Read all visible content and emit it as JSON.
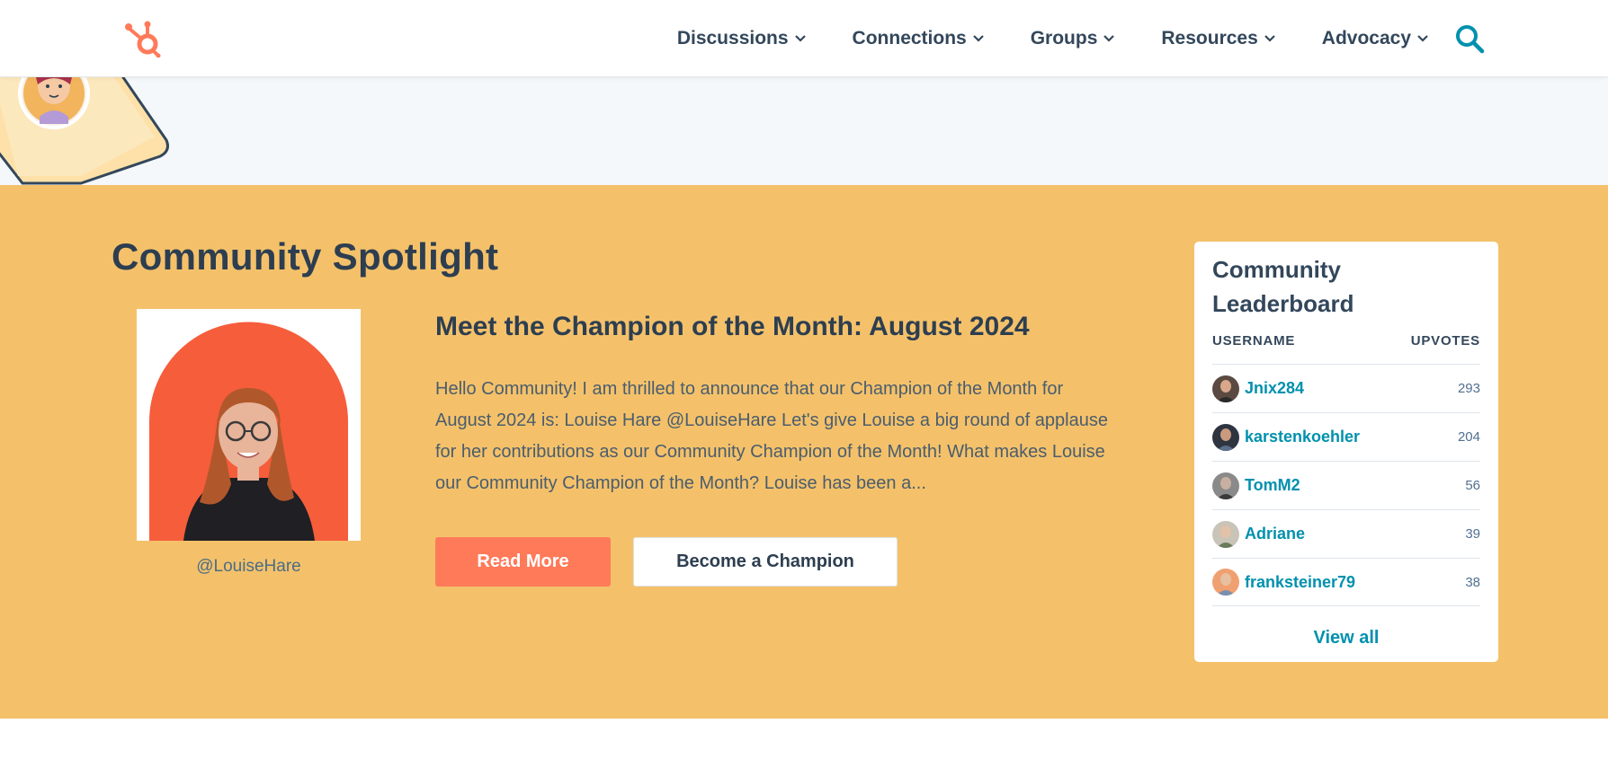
{
  "nav": {
    "items": [
      {
        "label": "Discussions"
      },
      {
        "label": "Connections"
      },
      {
        "label": "Groups"
      },
      {
        "label": "Resources"
      },
      {
        "label": "Advocacy"
      }
    ],
    "accent": "#33475b",
    "search_icon": "search-icon",
    "logo_icon": "hubspot-sprocket-icon"
  },
  "spotlight": {
    "title": "Community Spotlight",
    "handle": "@LouiseHare",
    "champion_title": "Meet the Champion of the Month: August 2024",
    "body": "Hello Community! I am thrilled to announce that our Champion of the Month for August 2024 is: Louise Hare @LouiseHare Let's give Louise a big round of applause for her contributions as our Community Champion of the Month! What makes Louise our Community Champion of the Month? Louise has been a...",
    "read_more": "Read More",
    "become_champion": "Become a Champion",
    "background": "#f4c16a"
  },
  "leaderboard": {
    "title": "Community Leaderboard",
    "col_username": "USERNAME",
    "col_upvotes": "UPVOTES",
    "rows": [
      {
        "username": "Jnix284",
        "upvotes": "293"
      },
      {
        "username": "karstenkoehler",
        "upvotes": "204"
      },
      {
        "username": "TomM2",
        "upvotes": "56"
      },
      {
        "username": "Adriane",
        "upvotes": "39"
      },
      {
        "username": "franksteiner79",
        "upvotes": "38"
      }
    ],
    "view_all": "View all",
    "link_color": "#0091ae"
  }
}
